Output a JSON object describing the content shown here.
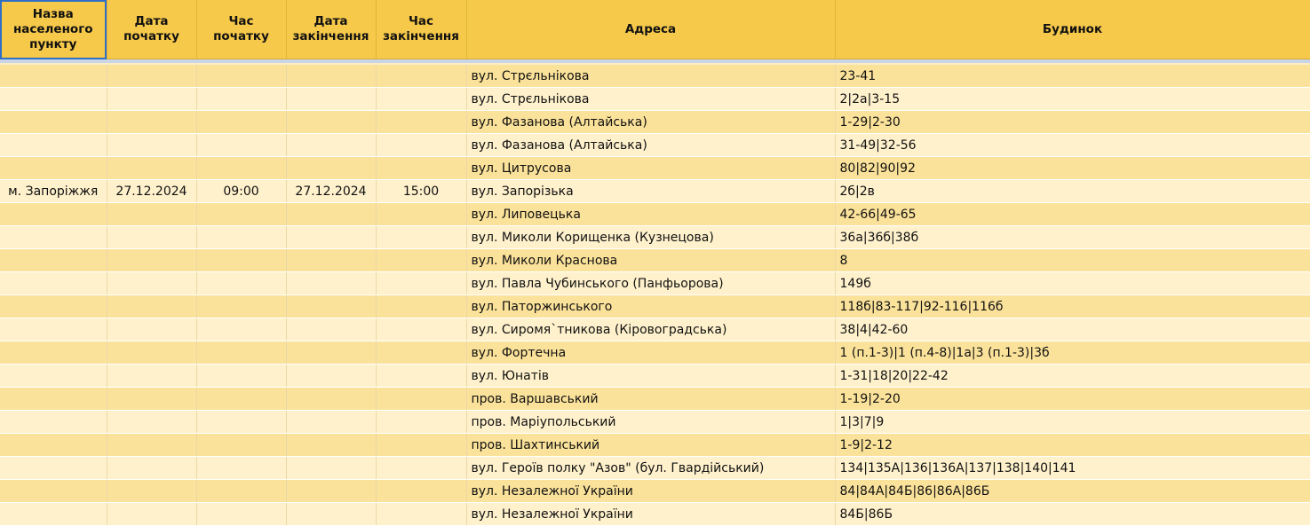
{
  "headers": {
    "settlement": "Назва населеного пункту",
    "start_date": "Дата початку",
    "start_time": "Час початку",
    "end_date": "Дата закінчення",
    "end_time": "Час закінчення",
    "address": "Адреса",
    "building": "Будинок"
  },
  "group": {
    "settlement": "м. Запоріжжя",
    "start_date": "27.12.2024",
    "start_time": "09:00",
    "end_date": "27.12.2024",
    "end_time": "15:00"
  },
  "rows": [
    {
      "address": "вул. Стрєльнікова",
      "building": "23-41"
    },
    {
      "address": "вул. Стрєльнікова",
      "building": "2|2а|3-15"
    },
    {
      "address": "вул. Фазанова (Алтайська)",
      "building": "1-29|2-30"
    },
    {
      "address": "вул. Фазанова (Алтайська)",
      "building": "31-49|32-56"
    },
    {
      "address": "вул. Цитрусова",
      "building": "80|82|90|92"
    },
    {
      "address": "вул. Запорізька",
      "building": "2б|2в"
    },
    {
      "address": "вул. Липовецька",
      "building": "42-66|49-65"
    },
    {
      "address": "вул. Миколи Корищенка (Кузнецова)",
      "building": "36а|36б|38б"
    },
    {
      "address": "вул. Миколи Краснова",
      "building": "8"
    },
    {
      "address": "вул. Павла Чубинського (Панфьорова)",
      "building": "149б"
    },
    {
      "address": "вул. Паторжинського",
      "building": "118б|83-117|92-116|116б"
    },
    {
      "address": "вул. Сиромя`тникова (Кіровоградська)",
      "building": "38|4|42-60"
    },
    {
      "address": "вул. Фортечна",
      "building": "1 (п.1-3)|1 (п.4-8)|1а|3 (п.1-3)|3б"
    },
    {
      "address": "вул. Юнатів",
      "building": "1-31|18|20|22-42"
    },
    {
      "address": "пров. Варшавський",
      "building": "1-19|2-20"
    },
    {
      "address": "пров. Маріупольський",
      "building": "1|3|7|9"
    },
    {
      "address": "пров. Шахтинський",
      "building": "1-9|2-12"
    },
    {
      "address": "вул. Героїв полку \"Азов\" (бул. Гвардійський)",
      "building": "134|135А|136|136А|137|138|140|141"
    },
    {
      "address": "вул. Незалежної України",
      "building": "84|84А|84Б|86|86А|86Б"
    },
    {
      "address": "вул. Незалежної України",
      "building": "84Б|86Б"
    }
  ]
}
